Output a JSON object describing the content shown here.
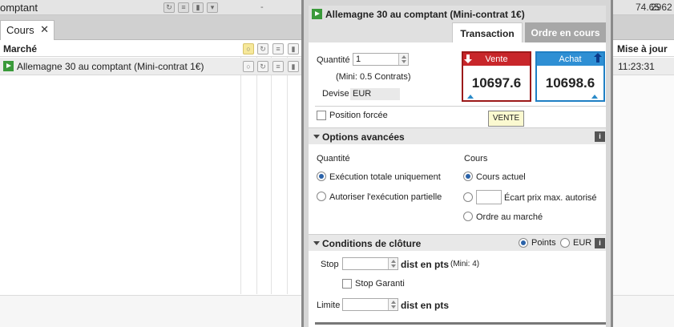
{
  "background": {
    "top_text": "omptant",
    "top_num1": "74.65",
    "top_num2": "2962",
    "top_dash": "-",
    "tab_label": "Cours",
    "tab_close": "✕",
    "col_market": "Marché",
    "col_update": "Mise à jour",
    "row_market": "Allemagne 30 au comptant (Mini-contrat 1€)",
    "row_time": "11:23:31"
  },
  "dialog": {
    "title": "Allemagne 30 au comptant (Mini-contrat 1€)",
    "tabs": [
      {
        "label": "Transaction",
        "active": true
      },
      {
        "label": "Ordre en cours",
        "active": false
      }
    ],
    "quantity_label": "Quantité",
    "quantity_value": "1",
    "mini_note": "(Mini: 0.5 Contrats)",
    "devise_label": "Devise",
    "devise_value": "EUR",
    "sell": {
      "label": "Vente",
      "price": "10697.6"
    },
    "buy": {
      "label": "Achat",
      "price": "10698.6"
    },
    "tooltip": "VENTE",
    "position_forcee": "Position forcée",
    "advanced": {
      "title": "Options avancées",
      "qty_header": "Quantité",
      "qty_opt1": "Exécution totale uniquement",
      "qty_opt2": "Autoriser l'exécution partielle",
      "price_header": "Cours",
      "price_opt1": "Cours actuel",
      "price_opt2": "Écart prix max. autorisé",
      "price_opt3": "Ordre au marché"
    },
    "closing": {
      "title": "Conditions de clôture",
      "unit_points": "Points",
      "unit_eur": "EUR",
      "stop_label": "Stop",
      "stop_unit": "dist en pts",
      "stop_mini": "(Mini: 4)",
      "stop_garanti": "Stop Garanti",
      "limit_label": "Limite",
      "limit_unit": "dist en pts"
    },
    "info_icon": "i"
  },
  "colors": {
    "sell": "#c8262a",
    "buy": "#2e8fd4",
    "play": "#3a9a3a"
  }
}
